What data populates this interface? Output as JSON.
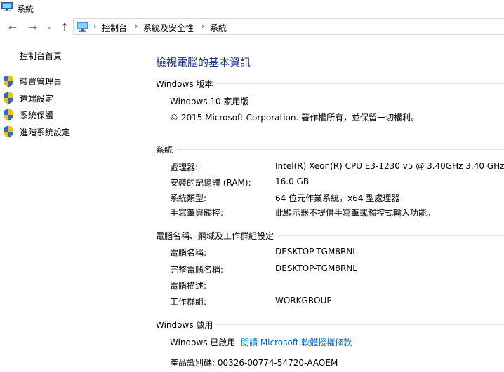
{
  "window": {
    "title": "系統"
  },
  "address": {
    "crumbs": [
      "控制台",
      "系統及安全性",
      "系統"
    ],
    "separator": "›"
  },
  "nav": {
    "back": "←",
    "forward": "→",
    "dropdown": "⌄",
    "up": "↑"
  },
  "sidebar": {
    "home": "控制台首頁",
    "items": [
      {
        "label": "裝置管理員"
      },
      {
        "label": "遠端設定"
      },
      {
        "label": "系統保護"
      },
      {
        "label": "進階系統設定"
      }
    ]
  },
  "main": {
    "title": "檢視電腦的基本資訊",
    "edition": {
      "heading": "Windows 版本",
      "name": "Windows 10 家用版",
      "copyright": "© 2015 Microsoft Corporation. 著作權所有，並保留一切權利。"
    },
    "system": {
      "heading": "系統",
      "rows": [
        {
          "label": "處理器:",
          "value": "Intel(R) Xeon(R) CPU E3-1230 v5 @ 3.40GHz   3.40 GHz"
        },
        {
          "label": "安裝的記憶體 (RAM):",
          "value": "16.0 GB"
        },
        {
          "label": "系統類型:",
          "value": "64 位元作業系統，x64 型處理器"
        },
        {
          "label": "手寫筆與觸控:",
          "value": "此顯示器不提供手寫筆或觸控式輸入功能。"
        }
      ]
    },
    "computer": {
      "heading": "電腦名稱、網域及工作群組設定",
      "rows": [
        {
          "label": "電腦名稱:",
          "value": "DESKTOP-TGM8RNL"
        },
        {
          "label": "完整電腦名稱:",
          "value": "DESKTOP-TGM8RNL"
        },
        {
          "label": "電腦描述:",
          "value": ""
        },
        {
          "label": "工作群組:",
          "value": "WORKGROUP"
        }
      ]
    },
    "activation": {
      "heading": "Windows 啟用",
      "status": "Windows 已啟用",
      "link": "閱讀 Microsoft 軟體授權條款",
      "product_id": "產品識別碼: 00326-00774-54720-AAOEM"
    }
  },
  "colors": {
    "title": "#1e3287",
    "link": "#0066cc",
    "shield_blue": "#2a6ac8",
    "shield_yellow": "#f2c200"
  }
}
